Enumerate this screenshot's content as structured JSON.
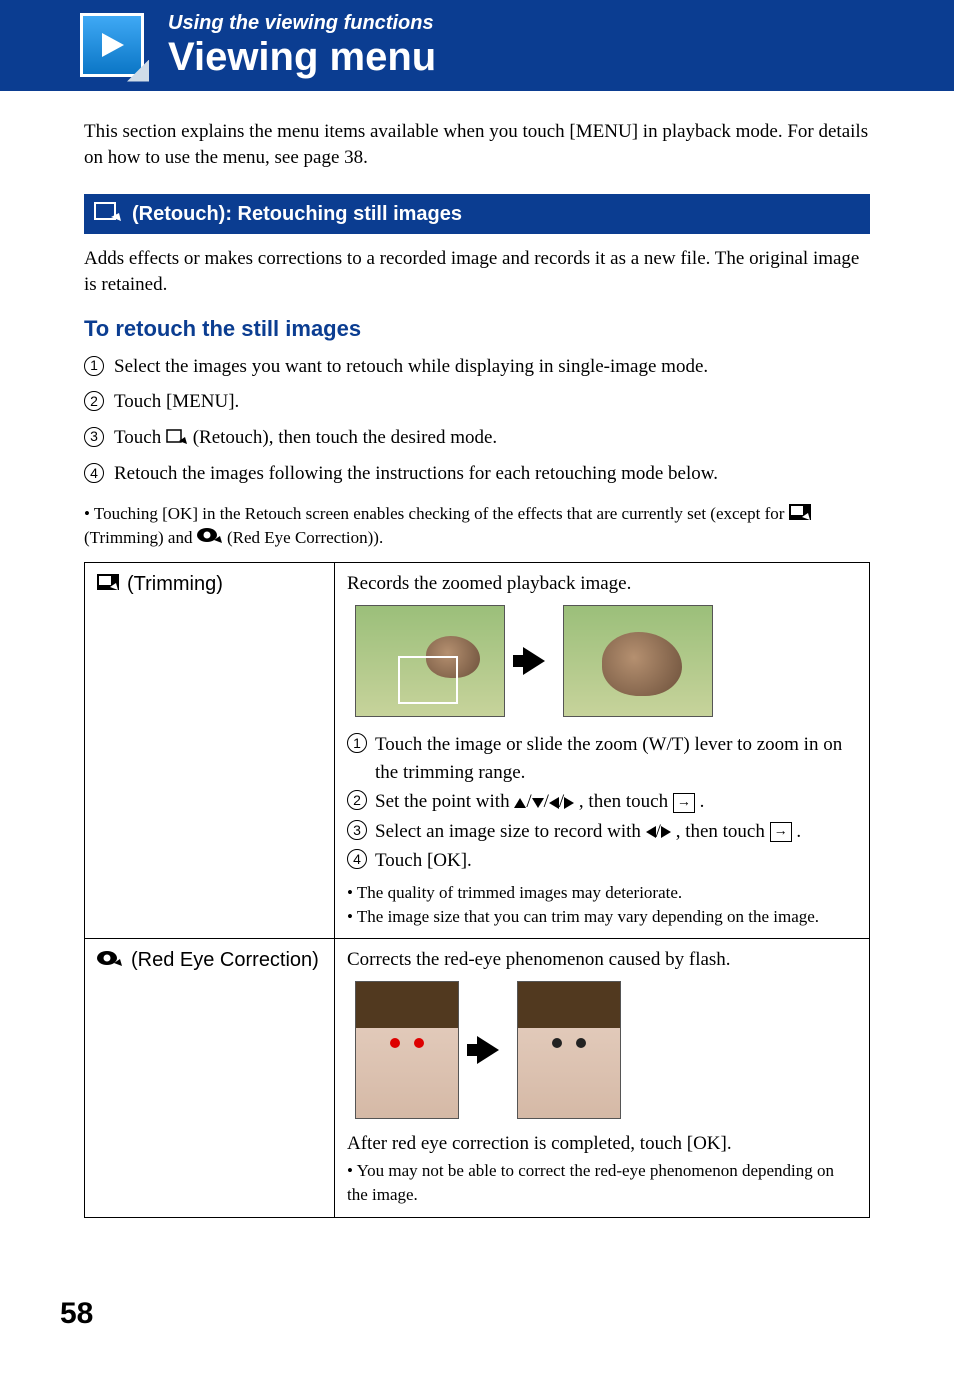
{
  "header": {
    "section_label": "Using the viewing functions",
    "page_title": "Viewing menu"
  },
  "intro": "This section explains the menu items available when you touch [MENU] in playback mode. For details on how to use the menu, see page 38.",
  "retouch_bar": {
    "title": " (Retouch): Retouching still images"
  },
  "retouch_desc": "Adds effects or makes corrections to a recorded image and records it as a new file. The original image is retained.",
  "sub_head": "To retouch the still images",
  "steps": [
    "Select the images you want to retouch while displaying in single-image mode.",
    "Touch [MENU].",
    {
      "pre": "Touch ",
      "post": " (Retouch), then touch the desired mode."
    },
    "Retouch the images following the instructions for each retouching mode below."
  ],
  "top_note": {
    "pre": "Touching [OK] in the Retouch screen enables checking of the effects that are currently set (except for ",
    "mid1": " (Trimming) and ",
    "mid2": " (Red Eye Correction)).",
    "trim_label": "(Trimming)",
    "eye_label": "(Red Eye Correction)"
  },
  "table": {
    "trimming": {
      "label": " (Trimming)",
      "desc": "Records the zoomed playback image.",
      "steps": [
        "Touch the image or slide the zoom (W/T) lever to zoom in on the trimming range.",
        {
          "pre": "Set the point with ",
          "mid": ", then touch ",
          "post": "."
        },
        {
          "pre": "Select an image size to record with ",
          "mid": ", then touch ",
          "post": "."
        },
        "Touch [OK]."
      ],
      "notes": [
        "The quality of trimmed images may deteriorate.",
        "The image size that you can trim may vary depending on the image."
      ]
    },
    "redeye": {
      "label": " (Red Eye Correction)",
      "desc": "Corrects the red-eye phenomenon caused by flash.",
      "after": "After red eye correction is completed, touch [OK].",
      "notes": [
        "You may not be able to correct the red-eye phenomenon depending on the image."
      ]
    }
  },
  "page_number": "58"
}
